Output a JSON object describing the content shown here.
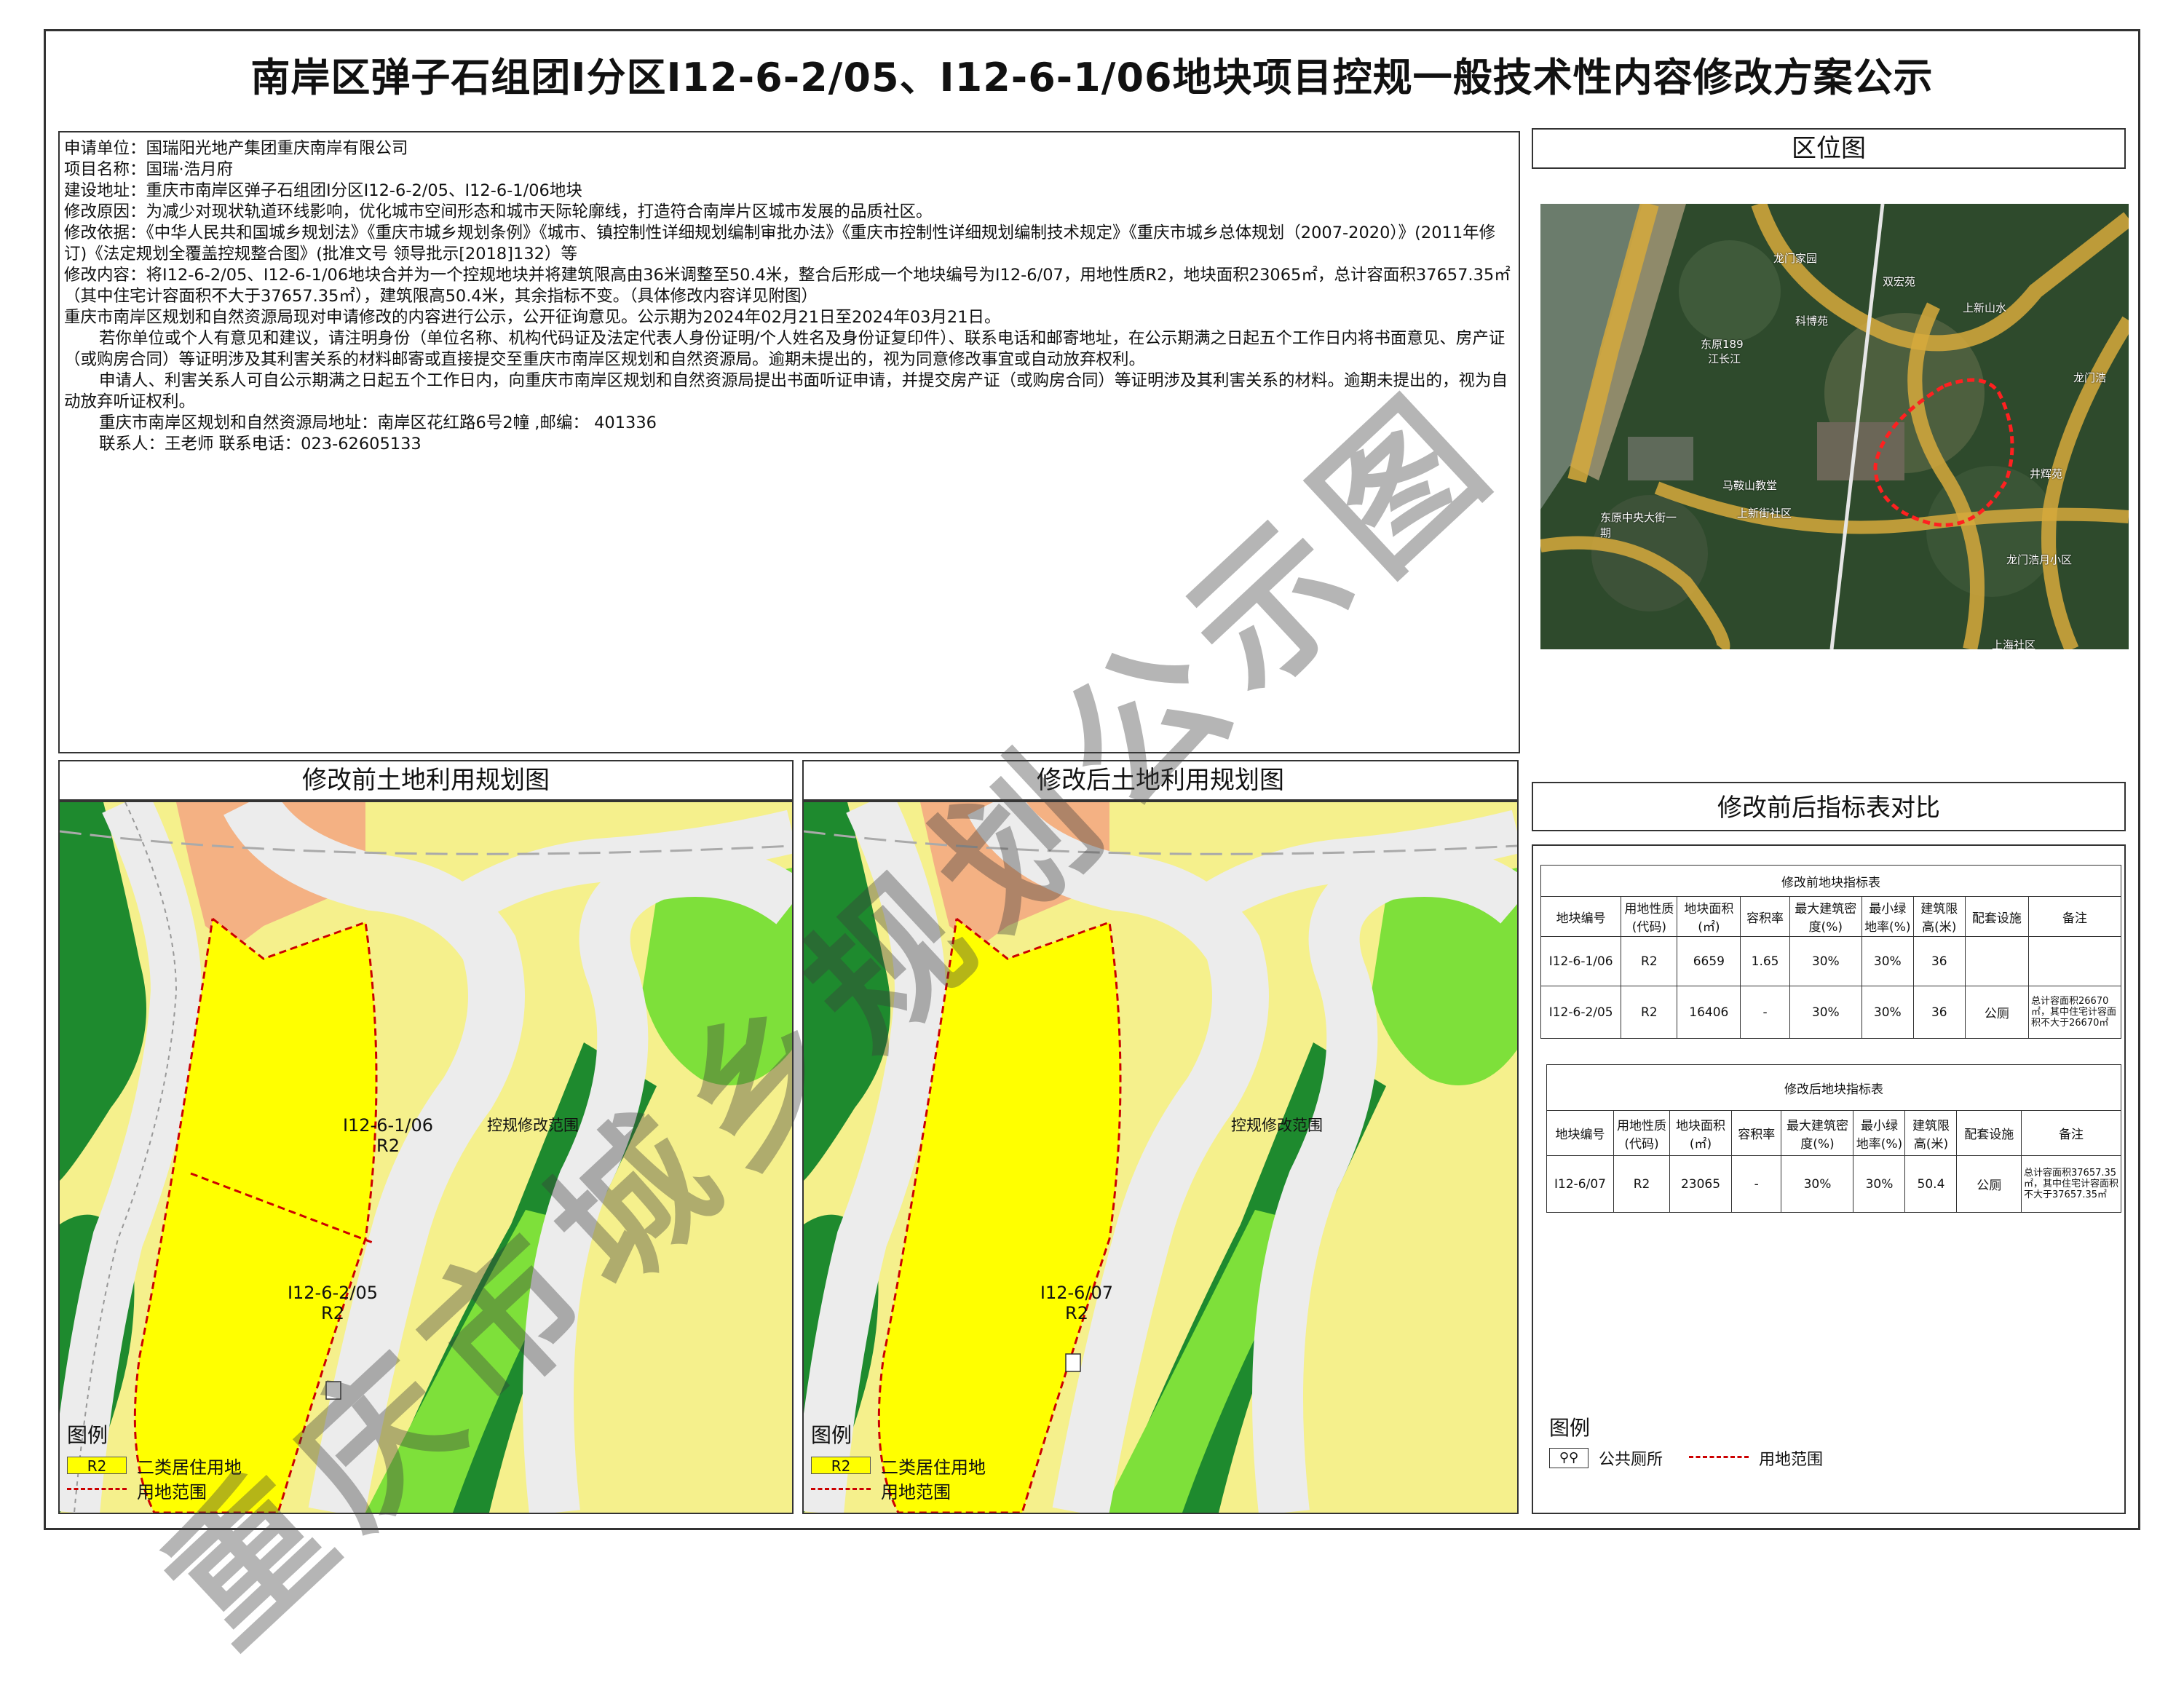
{
  "title": "南岸区弹子石组团I分区I12-6-2/05、I12-6-1/06地块项目控规一般技术性内容修改方案公示",
  "info": {
    "applicant": "申请单位：国瑞阳光地产集团重庆南岸有限公司",
    "project": "项目名称：国瑞·浩月府",
    "site": "建设地址：重庆市南岸区弹子石组团I分区I12-6-2/05、I12-6-1/06地块",
    "reason": "修改原因：为减少对现状轨道环线影响，优化城市空间形态和城市天际轮廓线，打造符合南岸片区城市发展的品质社区。",
    "basis": "修改依据：《中华人民共和国城乡规划法》《重庆市城乡规划条例》《城市、镇控制性详细规划编制审批办法》《重庆市控制性详细规划编制技术规定》《重庆市城乡总体规划（2007-2020）》(2011年修订)《法定规划全覆盖控规整合图》(批准文号 领导批示[2018]132）等",
    "content": "修改内容：将I12-6-2/05、I12-6-1/06地块合并为一个控规地块并将建筑限高由36米调整至50.4米，整合后形成一个地块编号为I12-6/07，用地性质R2，地块面积23065㎡，总计容面积37657.35㎡（其中住宅计容面积不大于37657.35㎡），建筑限高50.4米，其余指标不变。（具体修改内容详见附图）",
    "notice": "重庆市南岸区规划和自然资源局现对申请修改的内容进行公示，公开征询意见。公示期为2024年02月21日至2024年03月21日。",
    "para1": "若你单位或个人有意见和建议，请注明身份（单位名称、机构代码证及法定代表人身份证明/个人姓名及身份证复印件）、联系电话和邮寄地址，在公示期满之日起五个工作日内将书面意见、房产证（或购房合同）等证明涉及其利害关系的材料邮寄或直接提交至重庆市南岸区规划和自然资源局。逾期未提出的，视为同意修改事宜或自动放弃权利。",
    "para2": "申请人、利害关系人可自公示期满之日起五个工作日内，向重庆市南岸区规划和自然资源局提出书面听证申请，并提交房产证（或购房合同）等证明涉及其利害关系的材料。逾期未提出的，视为自动放弃听证权利。",
    "address": "重庆市南岸区规划和自然资源局地址：南岸区花红路6号2幢 ,邮编： 401336",
    "contact": "联系人：王老师    联系电话：023-62605133"
  },
  "location_panel": {
    "title": "区位图",
    "place_labels": [
      "龙门家园",
      "双宏苑",
      "上新山水",
      "科博苑",
      "东原189",
      "江长江",
      "马鞍山教堂",
      "上新街社区",
      "东原中央大街一期",
      "井辉苑",
      "龙门浩月小区",
      "上海社区",
      "龙门浩"
    ]
  },
  "before_map": {
    "title": "修改前土地利用规划图",
    "parcel_a_code": "I12-6-1/06",
    "parcel_a_use": "R2",
    "parcel_b_code": "I12-6-2/05",
    "parcel_b_use": "R2",
    "scope_label": "控规修改范围"
  },
  "after_map": {
    "title": "修改后土地利用规划图",
    "parcel_code": "I12-6/07",
    "parcel_use": "R2",
    "scope_label": "控规修改范围"
  },
  "map_legend": {
    "heading": "图例",
    "r2_code": "R2",
    "r2_label": "二类居住用地",
    "boundary_label": "用地范围"
  },
  "compare_panel": {
    "title": "修改前后指标表对比",
    "before_table": {
      "caption": "修改前地块指标表",
      "headers": [
        "地块编号",
        "用地性质(代码)",
        "地块面积(㎡)",
        "容积率",
        "最大建筑密度(%)",
        "最小绿地率(%)",
        "建筑限高(米)",
        "配套设施",
        "备注"
      ],
      "rows": [
        [
          "I12-6-1/06",
          "R2",
          "6659",
          "1.65",
          "30%",
          "30%",
          "36",
          "",
          ""
        ],
        [
          "I12-6-2/05",
          "R2",
          "16406",
          "-",
          "30%",
          "30%",
          "36",
          "公厕",
          "总计容面积26670㎡，其中住宅计容面积不大于26670㎡"
        ]
      ]
    },
    "after_table": {
      "caption": "修改后地块指标表",
      "headers": [
        "地块编号",
        "用地性质(代码)",
        "地块面积(㎡)",
        "容积率",
        "最大建筑密度(%)",
        "最小绿地率(%)",
        "建筑限高(米)",
        "配套设施",
        "备注"
      ],
      "rows": [
        [
          "I12-6/07",
          "R2",
          "23065",
          "-",
          "30%",
          "30%",
          "50.4",
          "公厕",
          "总计容面积37657.35㎡，其中住宅计容面积不大于37657.35㎡"
        ]
      ]
    },
    "legend_heading": "图例",
    "toilet_label": "公共厕所",
    "boundary_label": "用地范围"
  },
  "watermark": "重庆市城乡规划公示图",
  "colors": {
    "r2": "#ffff00",
    "residential_other": "#f5f08c",
    "commercial": "#f4b183",
    "green_dark": "#1e8a2e",
    "green_light": "#7ee03a",
    "boundary": "#cc0000"
  }
}
